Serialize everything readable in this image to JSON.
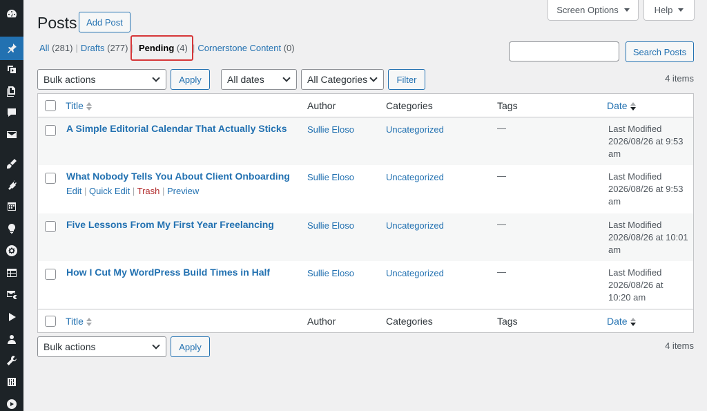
{
  "sidebar": {
    "icons": [
      "dashboard-icon",
      "pin-icon",
      "media-icon",
      "pages-icon",
      "comments-icon",
      "mail-icon",
      "appearance-icon",
      "plugins-icon",
      "calendar-icon",
      "lightbulb-icon",
      "settings-gear-icon",
      "table-icon",
      "email-icon",
      "play-icon",
      "users-icon",
      "tools-icon",
      "sliders-icon",
      "circle-play-icon"
    ],
    "active_index": 1,
    "accent_color": "#2271b1"
  },
  "header": {
    "title": "Posts",
    "add_post_label": "Add Post",
    "screen_options_label": "Screen Options",
    "help_label": "Help"
  },
  "filters": {
    "views": [
      {
        "label": "All",
        "count": "(281)"
      },
      {
        "label": "Drafts",
        "count": "(277)"
      },
      {
        "label": "Pending",
        "count": "(4)",
        "current": true
      },
      {
        "label": "Cornerstone Content",
        "count": "(0)"
      }
    ],
    "search_button_label": "Search Posts",
    "search_value": "",
    "bulk_actions_value": "Bulk actions",
    "apply_label": "Apply",
    "dates_value": "All dates",
    "categories_value": "All Categories",
    "filter_label": "Filter",
    "items_count": "4 items"
  },
  "table": {
    "columns": {
      "title": "Title",
      "author": "Author",
      "categories": "Categories",
      "tags": "Tags",
      "date": "Date"
    },
    "rows": [
      {
        "title": "A Simple Editorial Calendar That Actually Sticks",
        "author": "Sullie Eloso",
        "category": "Uncategorized",
        "tags": "—",
        "date_line1": "Last Modified",
        "date_line2": "2026/08/26 at 9:53",
        "date_line3": "am"
      },
      {
        "title": "What Nobody Tells You About Client Onboarding",
        "author": "Sullie Eloso",
        "category": "Uncategorized",
        "tags": "—",
        "date_line1": "Last Modified",
        "date_line2": "2026/08/26 at 9:53",
        "date_line3": "am",
        "actions": {
          "edit": "Edit",
          "quick_edit": "Quick Edit",
          "trash": "Trash",
          "preview": "Preview"
        }
      },
      {
        "title": "Five Lessons From My First Year Freelancing",
        "author": "Sullie Eloso",
        "category": "Uncategorized",
        "tags": "—",
        "date_line1": "Last Modified",
        "date_line2": "2026/08/26 at 10:01",
        "date_line3": "am"
      },
      {
        "title": "How I Cut My WordPress Build Times in Half",
        "author": "Sullie Eloso",
        "category": "Uncategorized",
        "tags": "—",
        "date_line1": "Last Modified",
        "date_line2": "2026/08/26 at",
        "date_line3": "10:20 am"
      }
    ]
  },
  "bottom": {
    "bulk_actions_value": "Bulk actions",
    "apply_label": "Apply",
    "items_count": "4 items"
  },
  "colors": {
    "link": "#2271b1",
    "highlight_border": "#d63638",
    "trash": "#b32d2e"
  }
}
